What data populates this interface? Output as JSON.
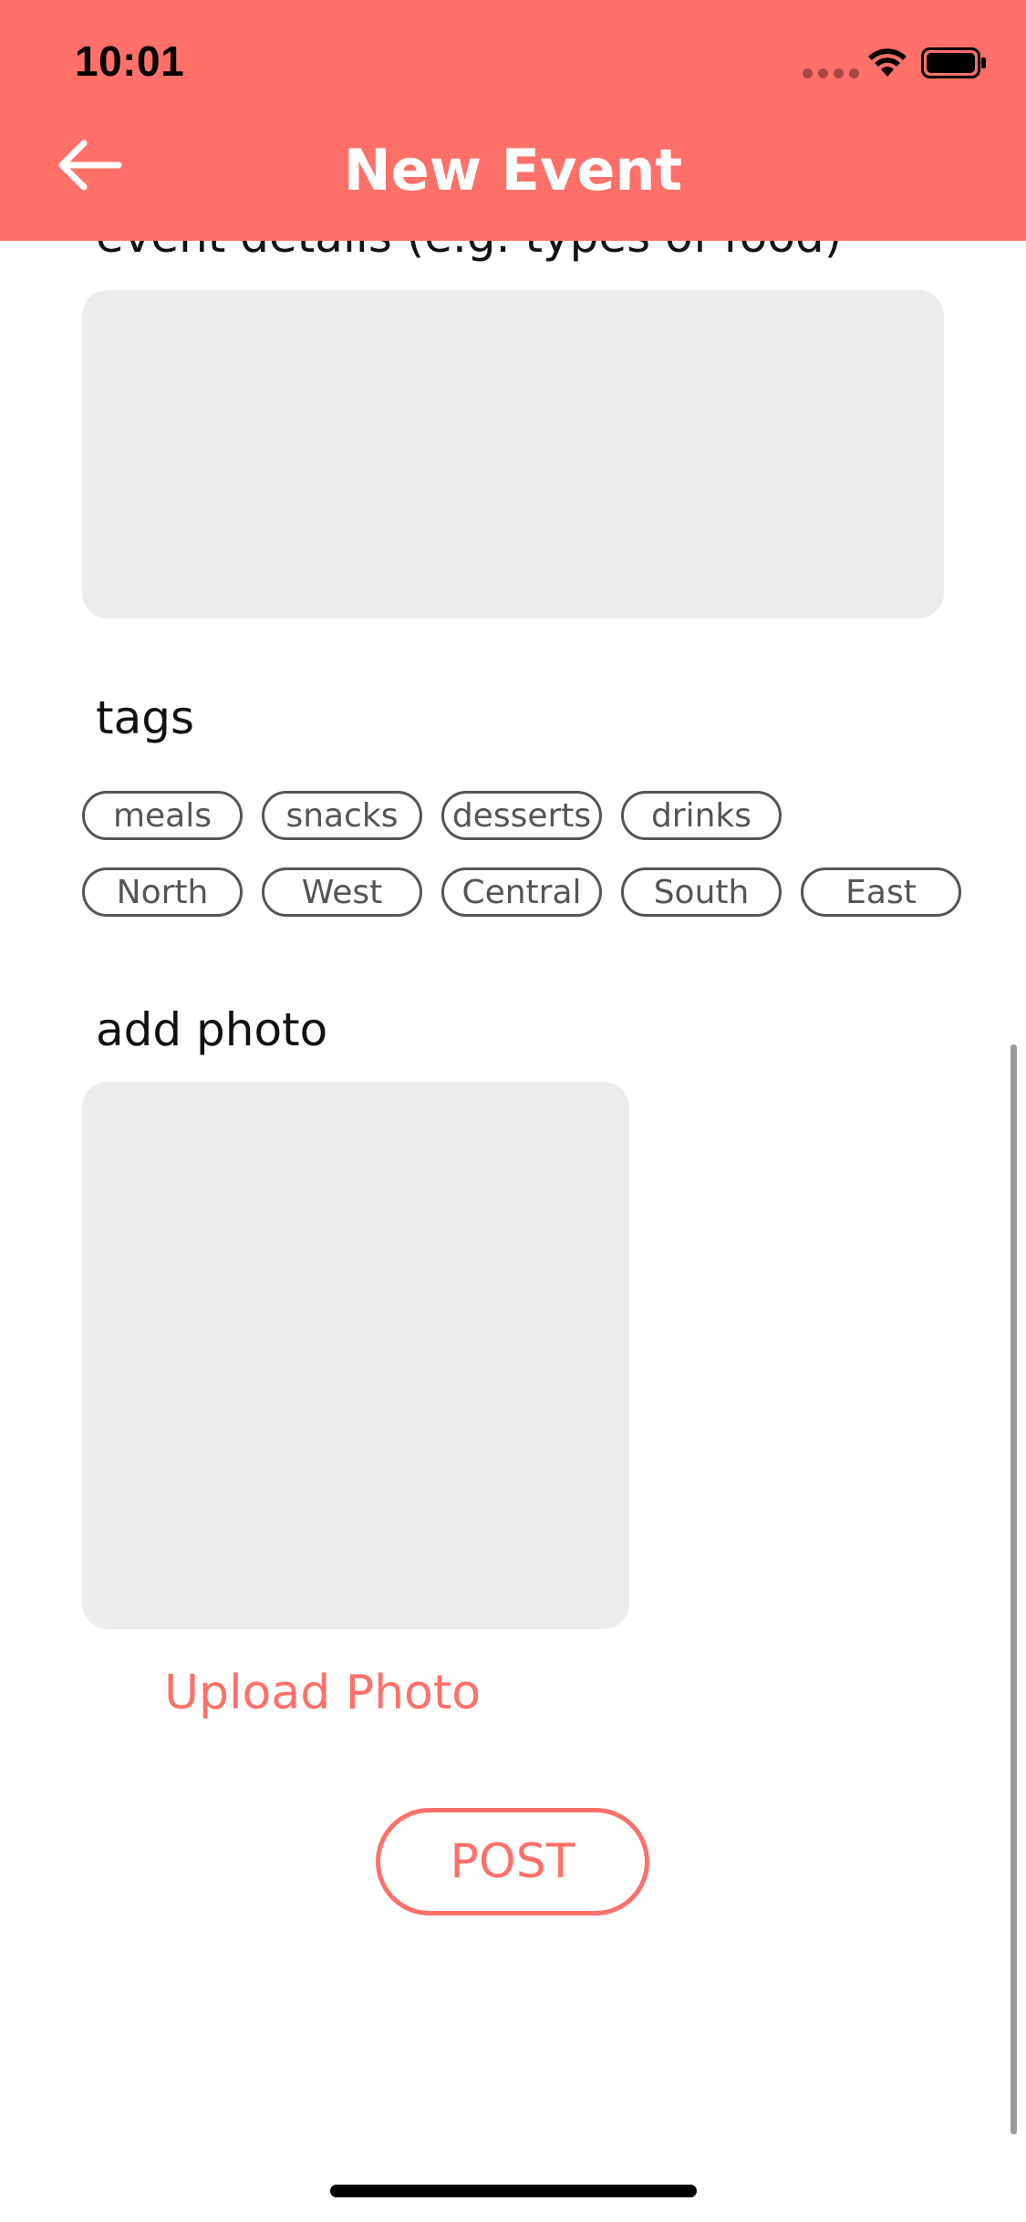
{
  "status_bar": {
    "time": "10:01"
  },
  "header": {
    "title": "New Event",
    "accent_color": "#ff7069"
  },
  "details": {
    "label": "event details (e.g. types of food)",
    "value": ""
  },
  "tags": {
    "label": "tags",
    "row1": [
      "meals",
      "snacks",
      "desserts",
      "drinks"
    ],
    "row2": [
      "North",
      "West",
      "Central",
      "South",
      "East"
    ]
  },
  "photo": {
    "label": "add photo",
    "upload_label": "Upload Photo"
  },
  "post_label": "POST",
  "icons": {
    "back": "arrow-left-icon",
    "wifi": "wifi-icon",
    "battery": "battery-icon"
  }
}
